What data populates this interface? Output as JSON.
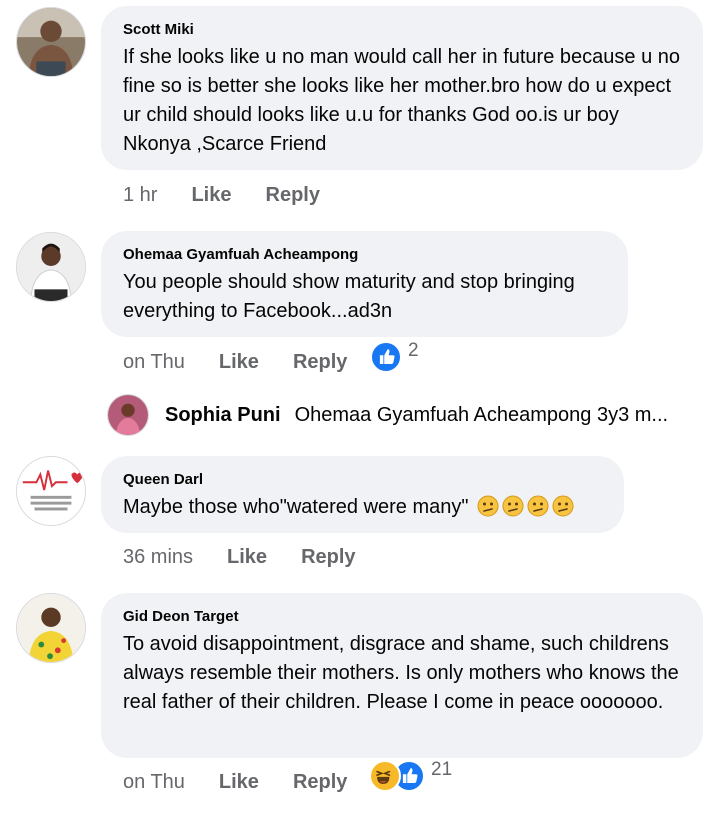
{
  "comments": [
    {
      "author": "Scott Miki",
      "text": "If she looks like u no man would call her in future because u no fine so is better she looks like her mother.bro how do u expect ur child should looks like u.u for thanks God oo.is ur boy Nkonya ,Scarce Friend",
      "time": "1 hr",
      "like_label": "Like",
      "reply_label": "Reply"
    },
    {
      "author": "Ohemaa Gyamfuah Acheampong",
      "text": "You people should show maturity and stop bringing everything to Facebook...ad3n",
      "time": "on Thu",
      "like_label": "Like",
      "reply_label": "Reply",
      "reaction_count": "2",
      "reaction_icons": [
        "like-reaction-icon"
      ]
    },
    {
      "author": "Queen Darl",
      "text": "Maybe those who\"watered were many\"",
      "emojis": [
        "confused-face-emoji",
        "confused-face-emoji",
        "confused-face-emoji",
        "confused-face-emoji"
      ],
      "time": "36 mins",
      "like_label": "Like",
      "reply_label": "Reply"
    },
    {
      "author": "Gid Deon Target",
      "text": "To avoid disappointment, disgrace and shame, such childrens always resemble their mothers. Is only mothers who knows the real father of their children. Please I come in peace ooooooo.",
      "time": "on Thu",
      "like_label": "Like",
      "reply_label": "Reply",
      "reaction_count": "21",
      "reaction_icons": [
        "haha-reaction-icon",
        "like-reaction-icon"
      ]
    }
  ],
  "reply_preview": {
    "author": "Sophia Puni",
    "text": "Ohemaa Gyamfuah Acheampong 3y3 m..."
  },
  "colors": {
    "bubble": "#f0f2f5",
    "meta_text": "#65676b",
    "like_blue": "#1877f2",
    "haha_yellow": "#f7b928"
  }
}
